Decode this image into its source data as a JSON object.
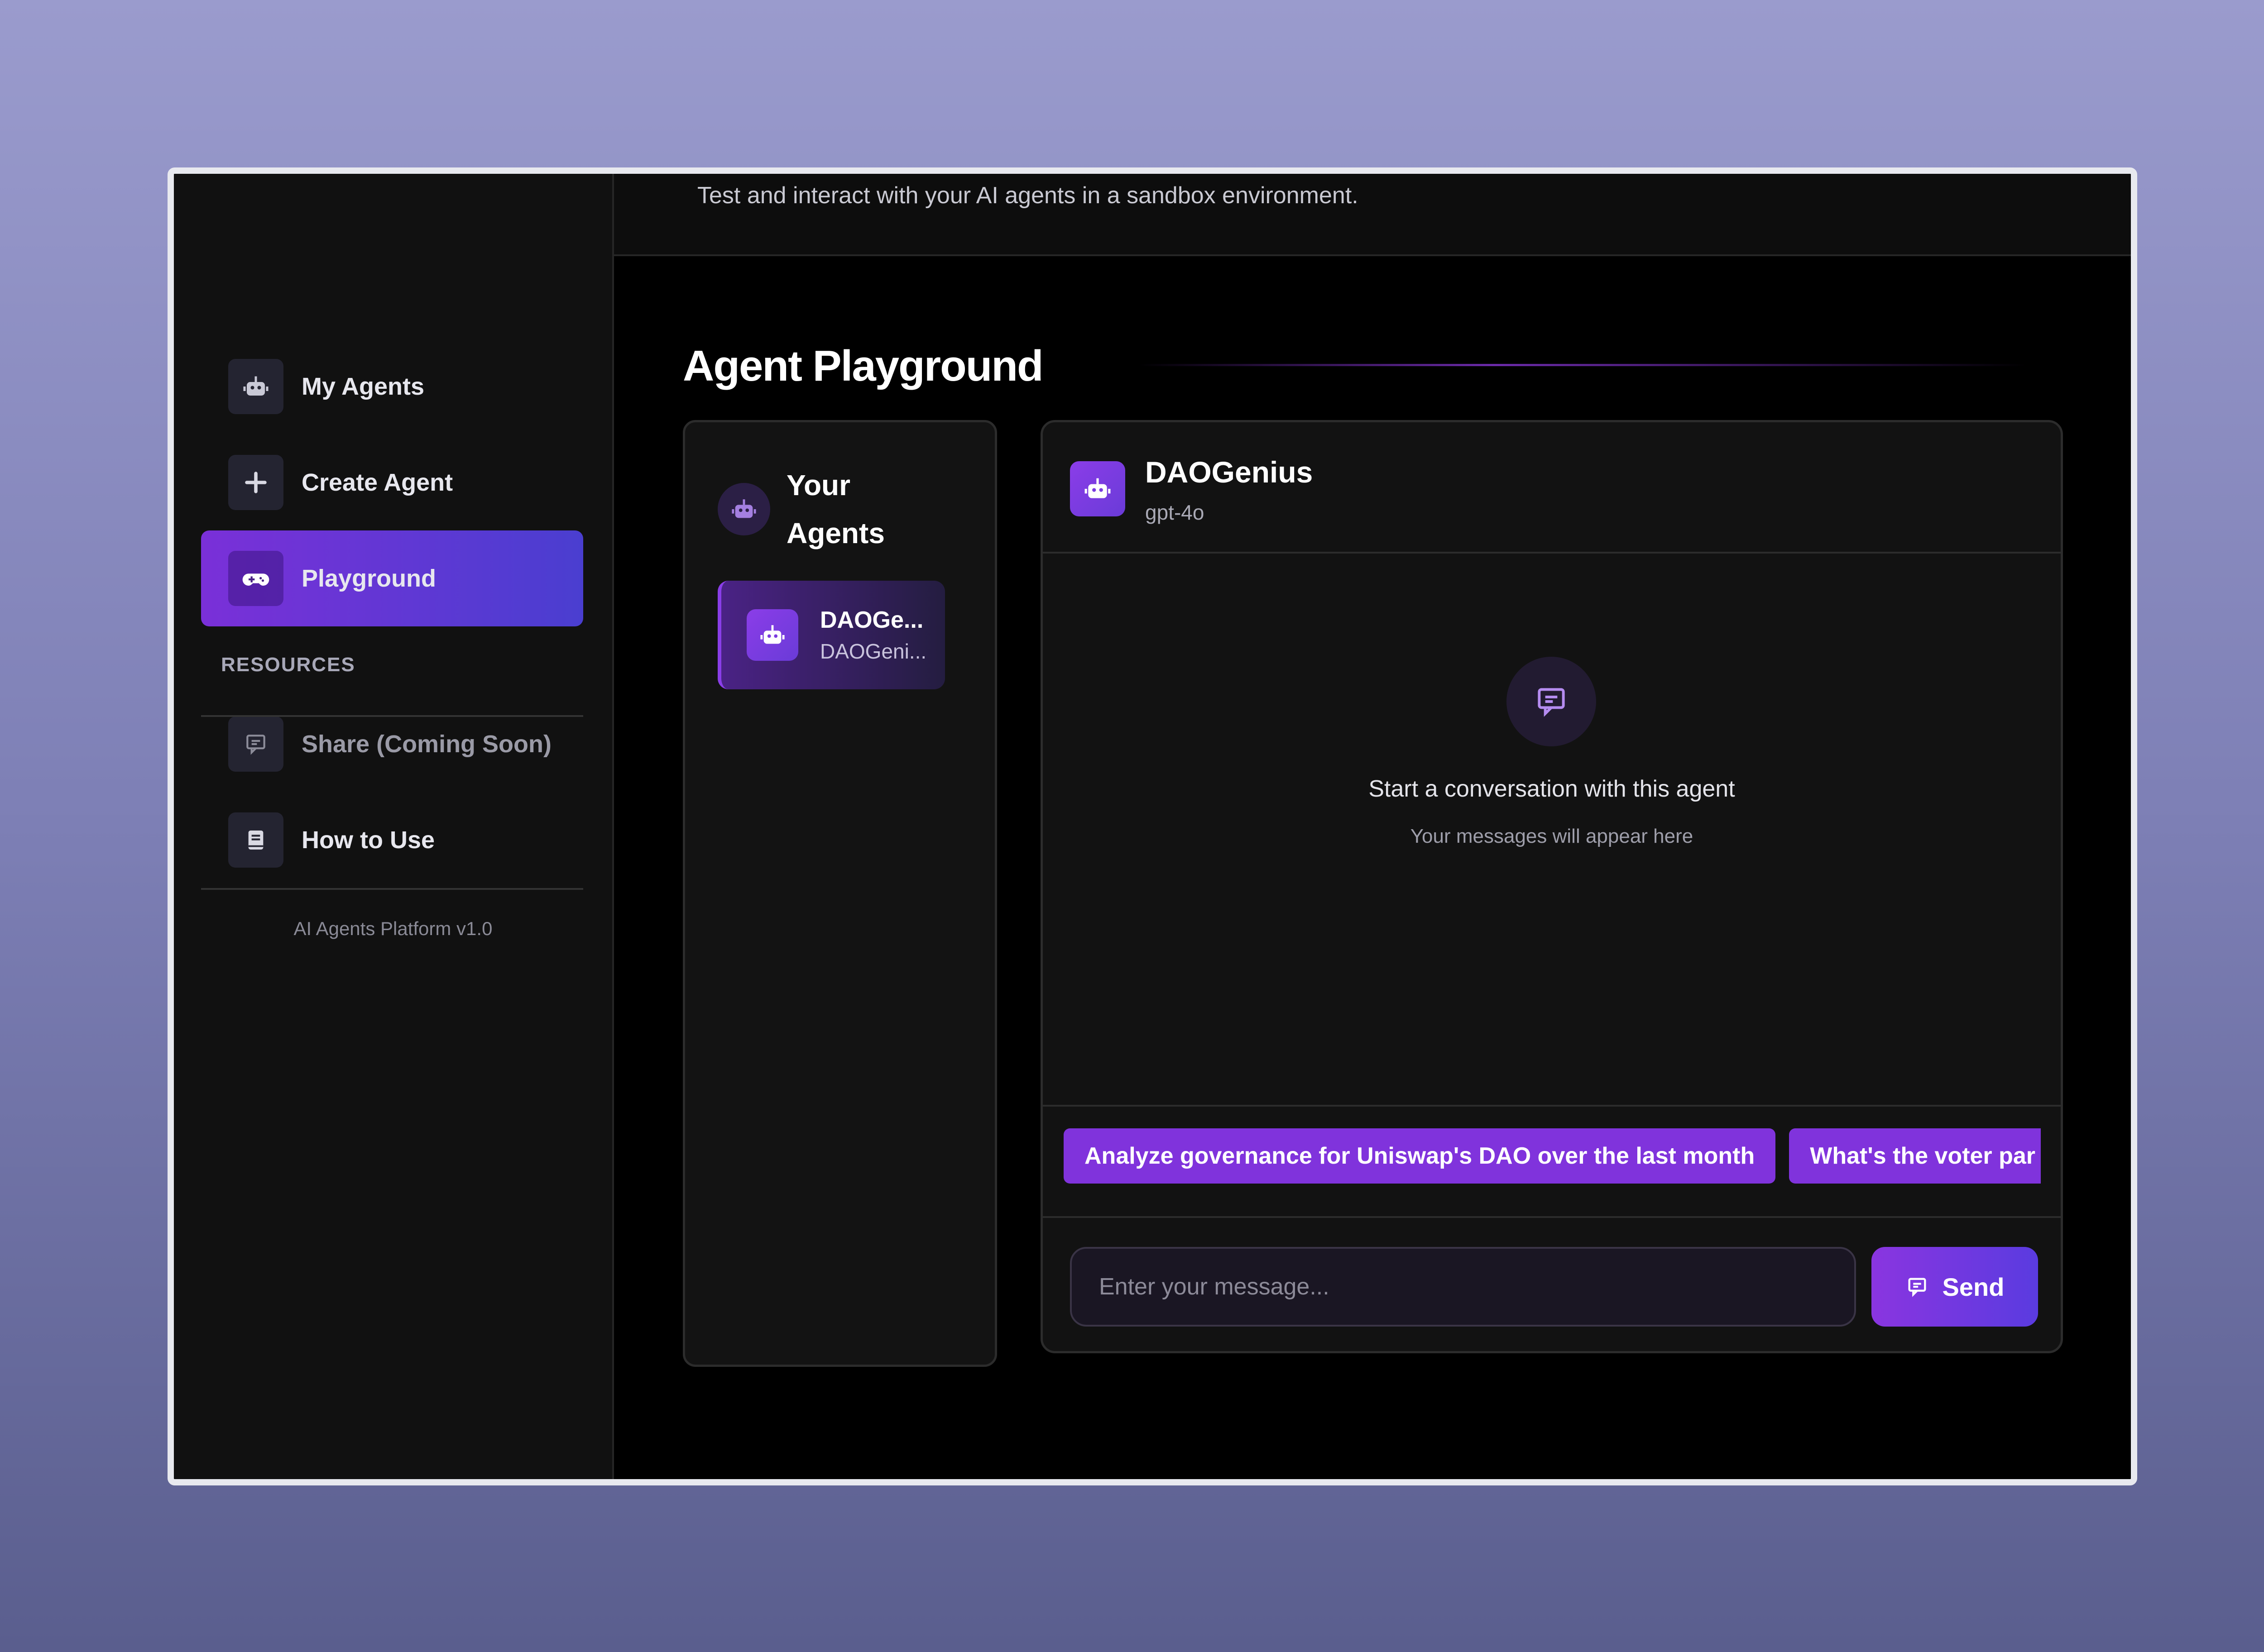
{
  "sidebar": {
    "items": [
      {
        "label": "My Agents",
        "icon": "robot-icon"
      },
      {
        "label": "Create Agent",
        "icon": "plus-icon"
      },
      {
        "label": "Playground",
        "icon": "gamepad-icon",
        "active": true
      }
    ],
    "resources_label": "RESOURCES",
    "resources": [
      {
        "label": "Share (Coming Soon)",
        "icon": "chat-icon",
        "disabled": true
      },
      {
        "label": "How to Use",
        "icon": "book-icon"
      }
    ],
    "version": "AI Agents Platform v1.0"
  },
  "header": {
    "subtitle": "Test and interact with your AI agents in a sandbox environment."
  },
  "main": {
    "title": "Agent Playground",
    "agents_panel": {
      "title": "Your Agents",
      "agents": [
        {
          "name": "DAOGe...",
          "subtitle": "DAOGeni..."
        }
      ]
    },
    "chat": {
      "agent_name": "DAOGenius",
      "model": "gpt-4o",
      "empty_title": "Start a conversation with this agent",
      "empty_subtitle": "Your messages will appear here",
      "suggestions": [
        "Analyze governance for Uniswap's DAO over the last month",
        "What's the voter par"
      ],
      "input_placeholder": "Enter your message...",
      "send_label": "Send"
    }
  },
  "colors": {
    "accent": "#8033dc",
    "accent_secondary": "#4a3ed0",
    "background": "#000000",
    "panel": "#121212"
  }
}
